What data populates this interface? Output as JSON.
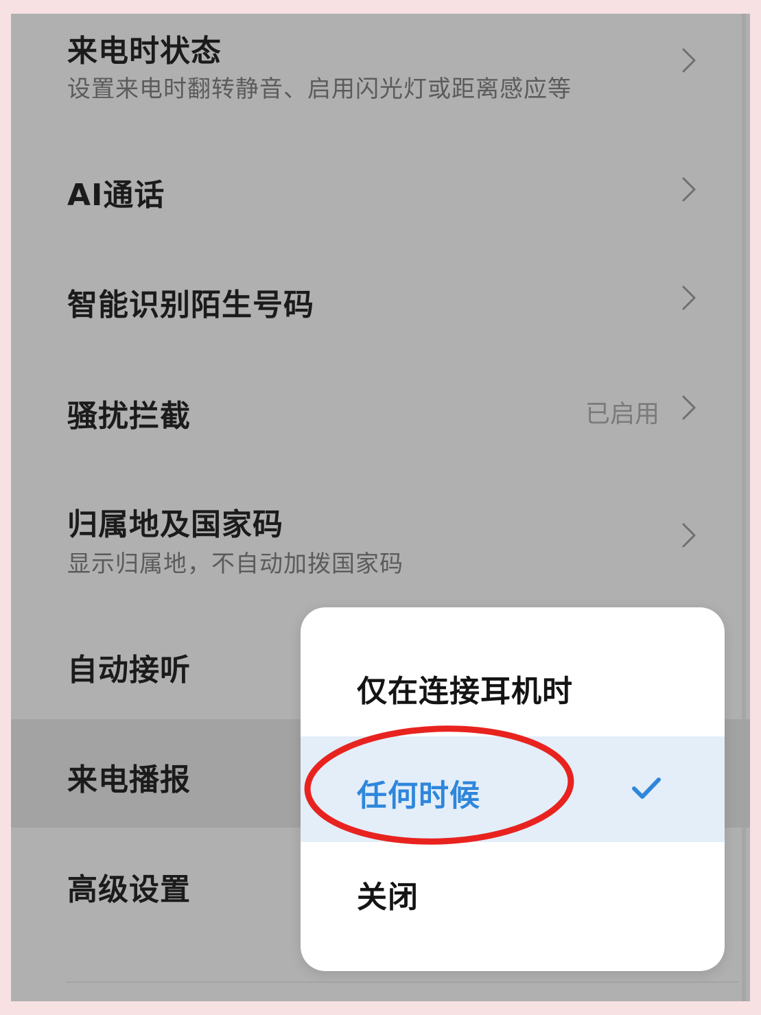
{
  "settings": {
    "items": [
      {
        "title": "来电时状态",
        "subtitle": "设置来电时翻转静音、启用闪光灯或距离感应等"
      },
      {
        "title": "AI通话"
      },
      {
        "title": "智能识别陌生号码"
      },
      {
        "title": "骚扰拦截",
        "value": "已启用"
      },
      {
        "title": "归属地及国家码",
        "subtitle": "显示归属地，不自动加拨国家码"
      },
      {
        "title": "自动接听"
      },
      {
        "title": "来电播报"
      },
      {
        "title": "高级设置"
      }
    ]
  },
  "popup": {
    "options": [
      {
        "label": "仅在连接耳机时",
        "selected": false
      },
      {
        "label": "任何时候",
        "selected": true
      },
      {
        "label": "关闭",
        "selected": false
      }
    ]
  },
  "colors": {
    "selected_accent": "#2f86db",
    "annotation_circle": "#e8231f"
  },
  "icons": {
    "row_arrow": "chevron-right-icon",
    "selected_mark": "checkmark-icon"
  }
}
